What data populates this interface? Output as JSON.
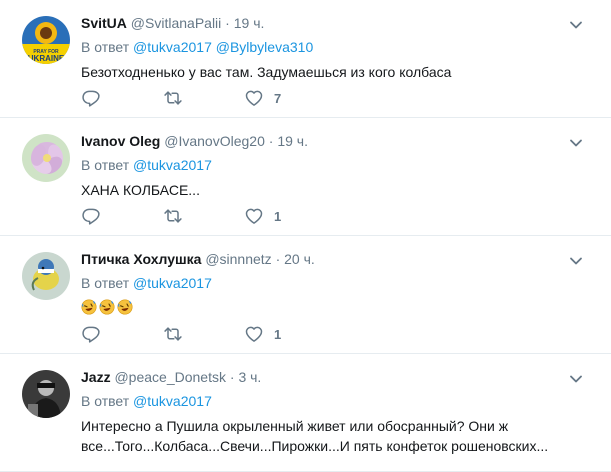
{
  "tweets": [
    {
      "name": "SvitUA",
      "handle": "@SvitlanaPalii",
      "time": "19 ч.",
      "reply_label": "В ответ",
      "mentions": "@tukva2017 @Bylbyleva310",
      "text": "Безотходненько у вас там. Задумаешься из кого колбаса",
      "likes": "7",
      "avatar_icon": "sunflower-avatar",
      "avatar_text": "PRAY FOR UKRAINE"
    },
    {
      "name": "Ivanov Oleg",
      "handle": "@IvanovOleg20",
      "time": "19 ч.",
      "reply_label": "В ответ",
      "mentions": "@tukva2017",
      "text": "ХАНА КОЛБАСЕ...",
      "likes": "1",
      "avatar_icon": "flower-avatar"
    },
    {
      "name": "Птичка Хохлушка",
      "handle": "@sinnnetz",
      "time": "20 ч.",
      "reply_label": "В ответ",
      "mentions": "@tukva2017",
      "text_emoji": "rofl-emoji x3",
      "likes": "1",
      "avatar_icon": "bird-avatar"
    },
    {
      "name": "Jazz",
      "handle": "@peace_Donetsk",
      "time": "3 ч.",
      "reply_label": "В ответ",
      "mentions": "@tukva2017",
      "text": "Интересно а Пушила окрыленный живет или обосранный? Они ж все...Того...Колбаса...Свечи...Пирожки...И пять конфеток рошеновских...",
      "avatar_icon": "person-avatar"
    }
  ],
  "separator": "·",
  "colors": {
    "accent": "#1b95e0",
    "muted": "#657786",
    "text": "#14171a",
    "border": "#e6ecf0"
  }
}
